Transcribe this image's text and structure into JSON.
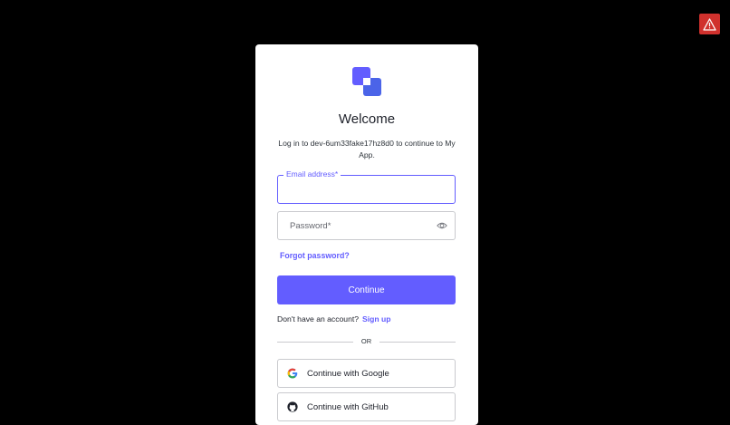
{
  "login": {
    "title": "Welcome",
    "subtitle": "Log in to dev-6um33fake17hz8d0 to continue to My App.",
    "email_label": "Email address*",
    "email_value": "",
    "password_placeholder": "Password*",
    "forgot_password": "Forgot password?",
    "continue_label": "Continue",
    "no_account_text": "Don't have an account?",
    "signup_label": "Sign up",
    "divider_text": "OR",
    "google_label": "Continue with Google",
    "github_label": "Continue with GitHub"
  },
  "colors": {
    "background": "#000000",
    "accent": "#635dff",
    "warning": "#d0312d"
  },
  "icons": {
    "warning": "warning-triangle-icon",
    "logo": "app-logo-icon",
    "password_toggle": "eye-icon",
    "google": "google-icon",
    "github": "github-icon"
  }
}
